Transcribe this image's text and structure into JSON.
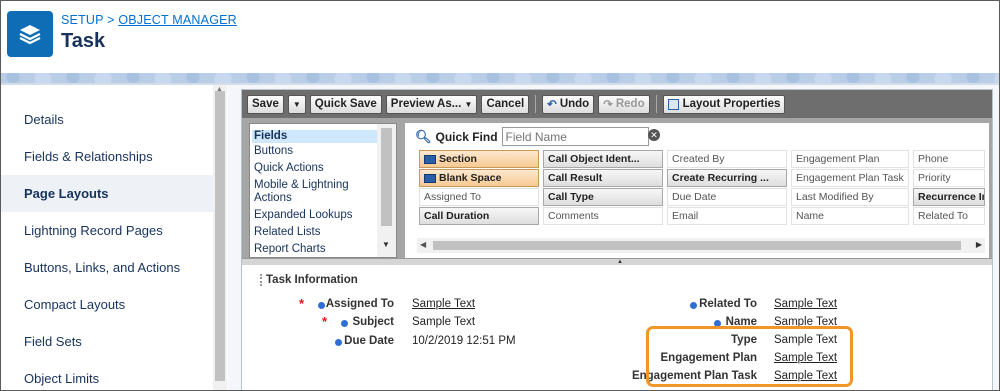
{
  "header": {
    "crumb_setup": "SETUP",
    "crumb_sep": ">",
    "crumb_object_manager": "OBJECT MANAGER",
    "title": "Task",
    "icon": "layers-icon"
  },
  "sidebar": {
    "items": [
      {
        "label": "Details"
      },
      {
        "label": "Fields & Relationships"
      },
      {
        "label": "Page Layouts"
      },
      {
        "label": "Lightning Record Pages"
      },
      {
        "label": "Buttons, Links, and Actions"
      },
      {
        "label": "Compact Layouts"
      },
      {
        "label": "Field Sets"
      },
      {
        "label": "Object Limits"
      }
    ],
    "active_index": 2
  },
  "toolbar": {
    "save": "Save",
    "quick_save": "Quick Save",
    "preview_as": "Preview As...",
    "cancel": "Cancel",
    "undo": "Undo",
    "redo": "Redo",
    "layout_properties": "Layout Properties"
  },
  "palette": {
    "categories": [
      "Fields",
      "Buttons",
      "Quick Actions",
      "Mobile & Lightning Actions",
      "Expanded Lookups",
      "Related Lists",
      "Report Charts"
    ],
    "selected_category": "Fields",
    "quick_find_label": "Quick Find",
    "quick_find_placeholder": "Field Name",
    "fields": [
      [
        "Section",
        "Call Object Ident...",
        "Created By",
        "Engagement Plan",
        "Phone"
      ],
      [
        "Blank Space",
        "Call Result",
        "Create Recurring ...",
        "Engagement Plan Task",
        "Priority"
      ],
      [
        "Assigned To",
        "Call Type",
        "Due Date",
        "Last Modified By",
        "Recurrence Int"
      ],
      [
        "Call Duration",
        "Comments",
        "Email",
        "Name",
        "Related To"
      ]
    ]
  },
  "layout": {
    "section_title": "Task Information",
    "left_fields": [
      {
        "label": "Assigned To",
        "value": "Sample Text",
        "required": true
      },
      {
        "label": "Subject",
        "value": "Sample Text",
        "required": true
      },
      {
        "label": "Due Date",
        "value": "10/2/2019 12:51 PM",
        "required": false
      }
    ],
    "right_fields": [
      {
        "label": "Related To",
        "value": "Sample Text"
      },
      {
        "label": "Name",
        "value": "Sample Text"
      },
      {
        "label": "Type",
        "value": "Sample Text"
      },
      {
        "label": "Engagement Plan",
        "value": "Sample Text"
      },
      {
        "label": "Engagement Plan Task",
        "value": "Sample Text"
      }
    ],
    "required_marker": "*"
  },
  "colors": {
    "accent": "#0070d2",
    "highlight": "#f0962a",
    "app_icon": "#0f6db5"
  }
}
